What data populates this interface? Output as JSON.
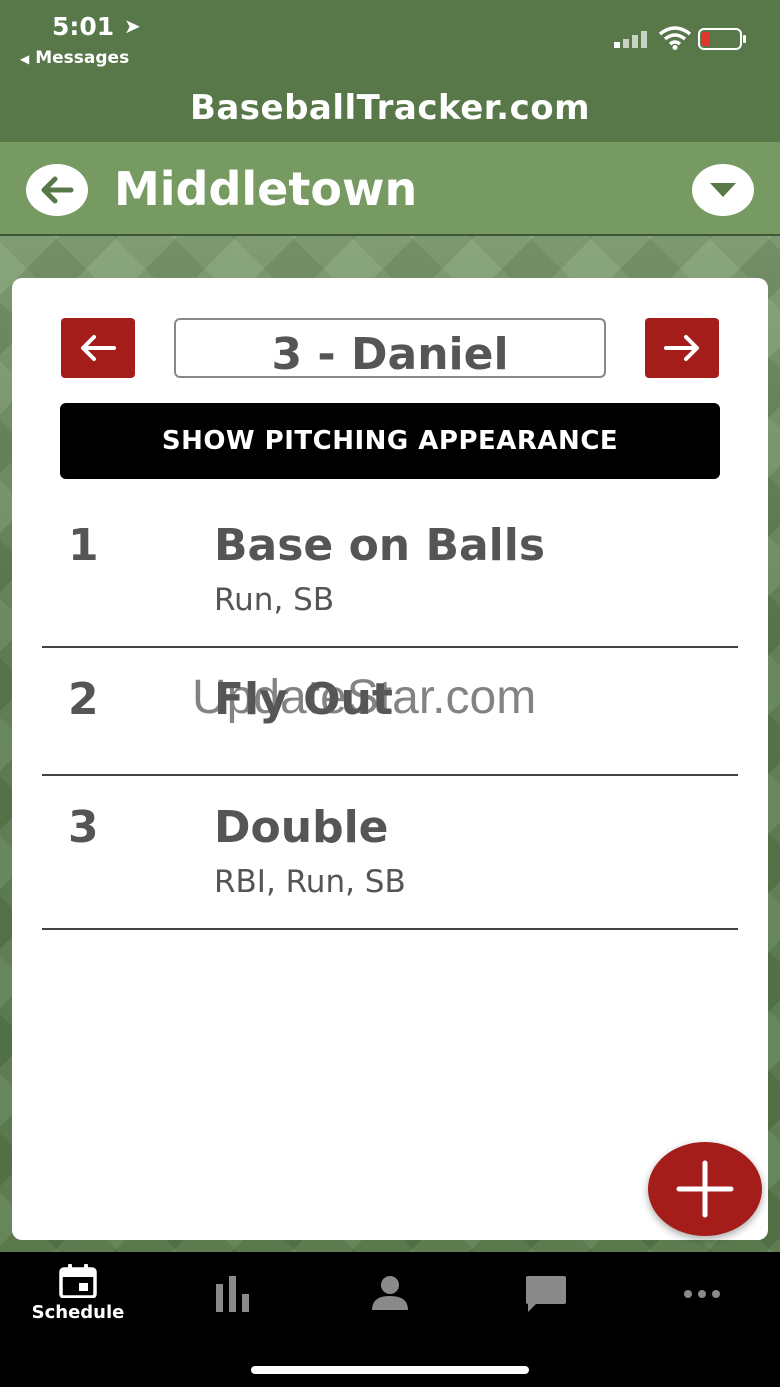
{
  "status_bar": {
    "time": "5:01",
    "back_label": "Messages"
  },
  "header": {
    "app_title": "BaseballTracker.com",
    "team_name": "Middletown"
  },
  "batter": {
    "current": "3 - Daniel"
  },
  "pitching_button_label": "SHOW PITCHING APPEARANCE",
  "appearances": [
    {
      "number": "1",
      "result": "Base on Balls",
      "detail": "Run, SB"
    },
    {
      "number": "2",
      "result": "Fly Out",
      "detail": ""
    },
    {
      "number": "3",
      "result": "Double",
      "detail": "RBI, Run, SB"
    }
  ],
  "watermark": "UpdateStar.com",
  "tabs": [
    {
      "label": "Schedule",
      "icon": "calendar-icon",
      "active": true
    },
    {
      "label": "",
      "icon": "bar-chart-icon"
    },
    {
      "label": "",
      "icon": "person-icon"
    },
    {
      "label": "",
      "icon": "chat-icon"
    },
    {
      "label": "",
      "icon": "more-icon"
    }
  ],
  "colors": {
    "header_green": "#58784a",
    "team_bar_green": "#779a63",
    "accent_red": "#a51d1b",
    "text_gray": "#555555"
  }
}
